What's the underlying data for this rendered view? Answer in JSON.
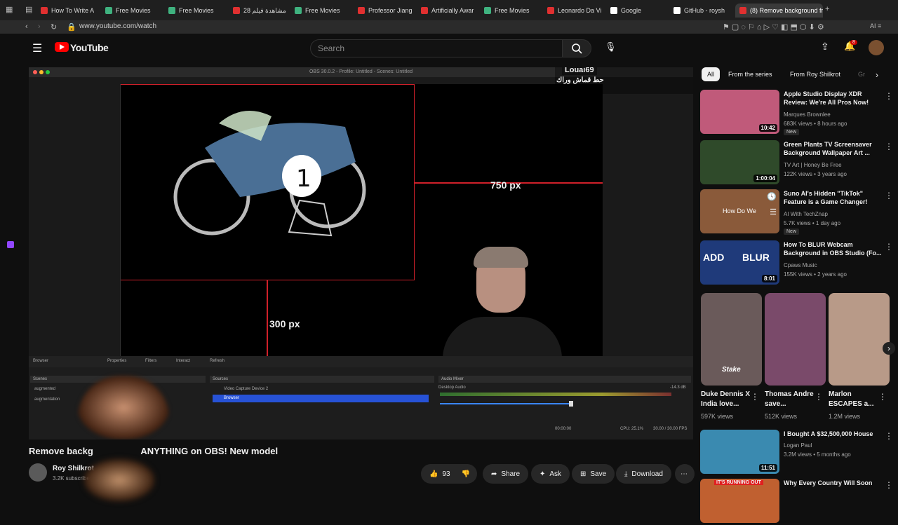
{
  "browser": {
    "tabs": [
      {
        "label": "How To Write A",
        "color": "#e03030"
      },
      {
        "label": "Free Movies",
        "color": "#3fb27f"
      },
      {
        "label": "Free Movies",
        "color": "#3fb27f"
      },
      {
        "label": "28 مشاهدة فيلم",
        "color": "#e03030"
      },
      {
        "label": "Free Movies",
        "color": "#3fb27f"
      },
      {
        "label": "Professor Jiang",
        "color": "#e03030"
      },
      {
        "label": "Artificially Awar",
        "color": "#e03030"
      },
      {
        "label": "Free Movies",
        "color": "#3fb27f"
      },
      {
        "label": "Leonardo Da Vi",
        "color": "#e03030"
      },
      {
        "label": "Google",
        "color": "#ffffff"
      },
      {
        "label": "GitHub - roysh",
        "color": "#ffffff"
      },
      {
        "label": "(8) Remove background fr",
        "color": "#e03030"
      }
    ],
    "url": "www.youtube.com/watch"
  },
  "header": {
    "logo_text": "YouTube",
    "search_placeholder": "Search",
    "notification_count": "8"
  },
  "video": {
    "obs_title": "OBS 30.0.2 - Profile: Untitled - Scenes: Untitled",
    "label_750": "750 px",
    "label_300": "300 px",
    "overlay_user": "Louai69",
    "overlay_text": "حط قماش وراك",
    "toolbar": [
      "Browser",
      "Properties",
      "Filters",
      "Interact",
      "Refresh"
    ],
    "docks": {
      "scenes": "Scenes",
      "sources": "Sources",
      "mixer": "Audio Mixer"
    },
    "scenes": [
      "augmented",
      "augmentation"
    ],
    "sources": [
      "Video Capture Device 2",
      "Browser"
    ],
    "audio_name": "Desktop Audio",
    "audio_db": "-14.3 dB",
    "status": "CPU: 25.1%",
    "fps": "30.00 / 30.00 FPS",
    "time": "00:00:00"
  },
  "meta": {
    "title_visible_left": "Remove backg",
    "title_visible_right": "ANYTHING on OBS! New model",
    "channel": "Roy Shilkrot",
    "subscribers": "3.2K subscribers",
    "likes": "93",
    "share": "Share",
    "ask": "Ask",
    "save": "Save",
    "download": "Download"
  },
  "sidebar": {
    "chips": [
      "All",
      "From the series",
      "From Roy Shilkrot",
      "Gr"
    ],
    "recs": [
      {
        "title": "Apple Studio Display XDR Review: We're All Pros Now!",
        "channel": "Marques Brownlee",
        "stats": "683K views • 8 hours ago",
        "badge": "New",
        "duration": "10:42",
        "thumb": "#c05a7a"
      },
      {
        "title": "Green Plants TV Screensaver Background Wallpaper Art ...",
        "channel": "TV Art | Honey Be Free",
        "stats": "122K views • 3 years ago",
        "badge": "",
        "duration": "1:00:04",
        "thumb": "#2f4a2a"
      },
      {
        "title": "Suno AI's Hidden \"TikTok\" Feature is a Game Changer!",
        "channel": "AI With TechZnap",
        "stats": "5.7K views • 1 day ago",
        "badge": "New",
        "duration": "",
        "thumb": "#8a5a3a"
      },
      {
        "title": "How To BLUR Webcam Background in OBS Studio (Fo...",
        "channel": "Cpaws Music",
        "stats": "155K views • 2 years ago",
        "badge": "",
        "duration": "8:01",
        "thumb": "#1f3a7a"
      }
    ],
    "shorts": [
      {
        "title": "Duke Dennis X India love...",
        "views": "597K views",
        "thumb": "#6a5a5a"
      },
      {
        "title": "Thomas Andre save...",
        "views": "512K views",
        "thumb": "#7a4a6a"
      },
      {
        "title": "Marlon ESCAPES a...",
        "views": "1.2M views",
        "thumb": "#b89a88"
      }
    ],
    "recs2": [
      {
        "title": "I Bought A $32,500,000 House",
        "channel": "Logan Paul",
        "stats": "3.2M views • 5 months ago",
        "duration": "11:51",
        "thumb": "#3a8ab0"
      },
      {
        "title": "Why Every Country Will Soon",
        "channel": "",
        "stats": "",
        "duration": "",
        "thumb": "#c06030"
      }
    ],
    "thumb_text_suno": "How Do We",
    "thumb_text_blur_1": "ADD",
    "thumb_text_blur_2": "BLUR",
    "thumb_text_short": "Stake",
    "thumb_text_country": "IT'S RUNNING OUT"
  }
}
